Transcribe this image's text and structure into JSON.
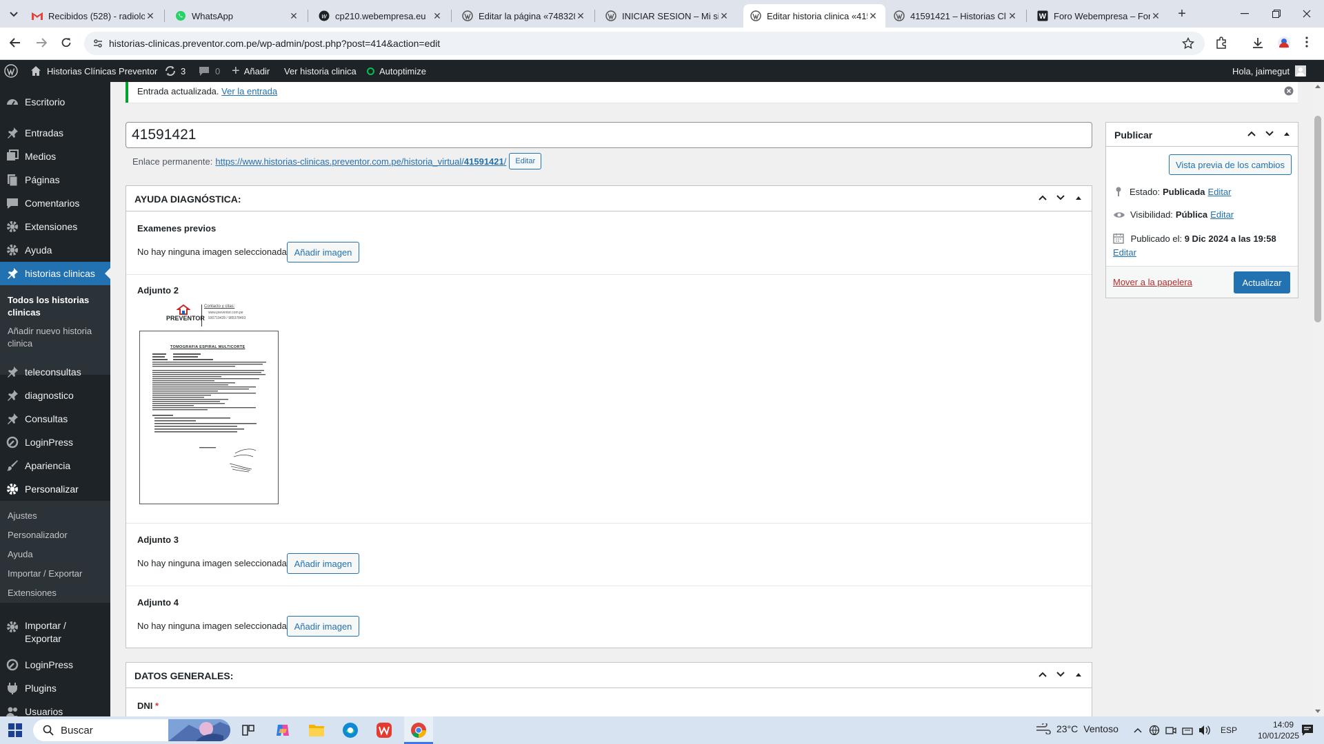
{
  "browser": {
    "tabs": [
      {
        "title": "Recibidos (528) - radiolog",
        "icon": "gmail-icon"
      },
      {
        "title": "WhatsApp",
        "icon": "whatsapp-icon"
      },
      {
        "title": "cp210.webempresa.eu",
        "icon": "webempresa-icon"
      },
      {
        "title": "Editar la página «7483282",
        "icon": "wordpress-icon"
      },
      {
        "title": "INICIAR SESION – Mi sitio",
        "icon": "wordpress-icon"
      },
      {
        "title": "Editar historia clinica «415",
        "icon": "wordpress-icon"
      },
      {
        "title": "41591421 – Historias Clín",
        "icon": "wordpress-icon"
      },
      {
        "title": "Foro Webempresa – Foro",
        "icon": "webempresa-icon"
      }
    ],
    "active_tab": 5,
    "url": "historias-clinicas.preventor.com.pe/wp-admin/post.php?post=414&action=edit"
  },
  "adminbar": {
    "site_name": "Historias Clínicas Preventor",
    "updates_count": "3",
    "comments_count": "0",
    "add_new": "Añadir",
    "view_item": "Ver historia clinica",
    "autoptimize": "Autoptimize",
    "greeting": "Hola, jaimegut"
  },
  "sidebar": {
    "items": [
      {
        "label": "Escritorio",
        "icon": "dashboard-icon"
      },
      {
        "label": "Entradas",
        "icon": "pin-icon"
      },
      {
        "label": "Medios",
        "icon": "media-icon"
      },
      {
        "label": "Páginas",
        "icon": "pages-icon"
      },
      {
        "label": "Comentarios",
        "icon": "comment-icon"
      },
      {
        "label": "Extensiones",
        "icon": "plugin-icon"
      },
      {
        "label": "Ayuda",
        "icon": "gear-icon"
      },
      {
        "label": "historias clinicas",
        "icon": "pin-icon"
      },
      {
        "label": "teleconsultas",
        "icon": "pin-icon"
      },
      {
        "label": "diagnostico",
        "icon": "pin-icon"
      },
      {
        "label": "Consultas",
        "icon": "pin-icon"
      },
      {
        "label": "LoginPress",
        "icon": "loginpress-icon"
      },
      {
        "label": "Apariencia",
        "icon": "brush-icon"
      },
      {
        "label": "Personalizar",
        "icon": "gear-icon"
      },
      {
        "label": "Importar / Exportar",
        "icon": "gear-icon"
      },
      {
        "label": "LoginPress",
        "icon": "loginpress-icon"
      },
      {
        "label": "Plugins",
        "icon": "plugin-icon"
      },
      {
        "label": "Usuarios",
        "icon": "users-icon"
      }
    ],
    "sub_historias": [
      "Todos los historias clinicas",
      "Añadir nuevo historia clinica"
    ],
    "sub_personalizar": [
      "Ajustes",
      "Personalizador",
      "Ayuda",
      "Importar / Exportar",
      "Extensiones"
    ]
  },
  "notice": {
    "text": "Entrada actualizada.",
    "link": "Ver la entrada"
  },
  "post": {
    "title": "41591421",
    "permalink_label": "Enlace permanente:",
    "permalink_url_prefix": "https://www.historias-clinicas.preventor.com.pe/historia_virtual/",
    "permalink_slug": "41591421",
    "permalink_end": "/",
    "edit_button": "Editar"
  },
  "metabox_ayuda": {
    "title": "AYUDA DIAGNÓSTICA:",
    "fields": [
      {
        "label": "Examenes previos",
        "empty_text": "No hay ninguna imagen seleccionada",
        "button": "Añadir imagen"
      },
      {
        "label": "Adjunto 2"
      },
      {
        "label": "Adjunto 3",
        "empty_text": "No hay ninguna imagen seleccionada",
        "button": "Añadir imagen"
      },
      {
        "label": "Adjunto 4",
        "empty_text": "No hay ninguna imagen seleccionada",
        "button": "Añadir imagen"
      }
    ]
  },
  "attachment_doc": {
    "logo": "PREVENTOR",
    "contact_title": "Contacto y citas:",
    "contact_web": "www.preventor.com.pe",
    "contact_phone": "930719428 / 985378493",
    "doc_title": "TOMOGRAFIA ESPIRAL MULTICORTE"
  },
  "metabox_datos": {
    "title": "DATOS GENERALES:",
    "first_field": "DNI",
    "required_mark": "*"
  },
  "publish": {
    "title": "Publicar",
    "preview_button": "Vista previa de los cambios",
    "status_label": "Estado:",
    "status_value": "Publicada",
    "visibility_label": "Visibilidad:",
    "visibility_value": "Pública",
    "published_label": "Publicado el:",
    "published_value": "9 Dic 2024 a las 19:58",
    "edit_link": "Editar",
    "trash_link": "Mover a la papelera",
    "update_button": "Actualizar"
  },
  "taskbar": {
    "search_placeholder": "Buscar",
    "weather_temp": "23°C",
    "weather_desc": "Ventoso",
    "lang": "ESP",
    "time": "14:09",
    "date": "10/01/2025"
  },
  "colors": {
    "wp_blue": "#2271b1",
    "admin_dark": "#1d2327",
    "notice_green": "#00a32a"
  }
}
